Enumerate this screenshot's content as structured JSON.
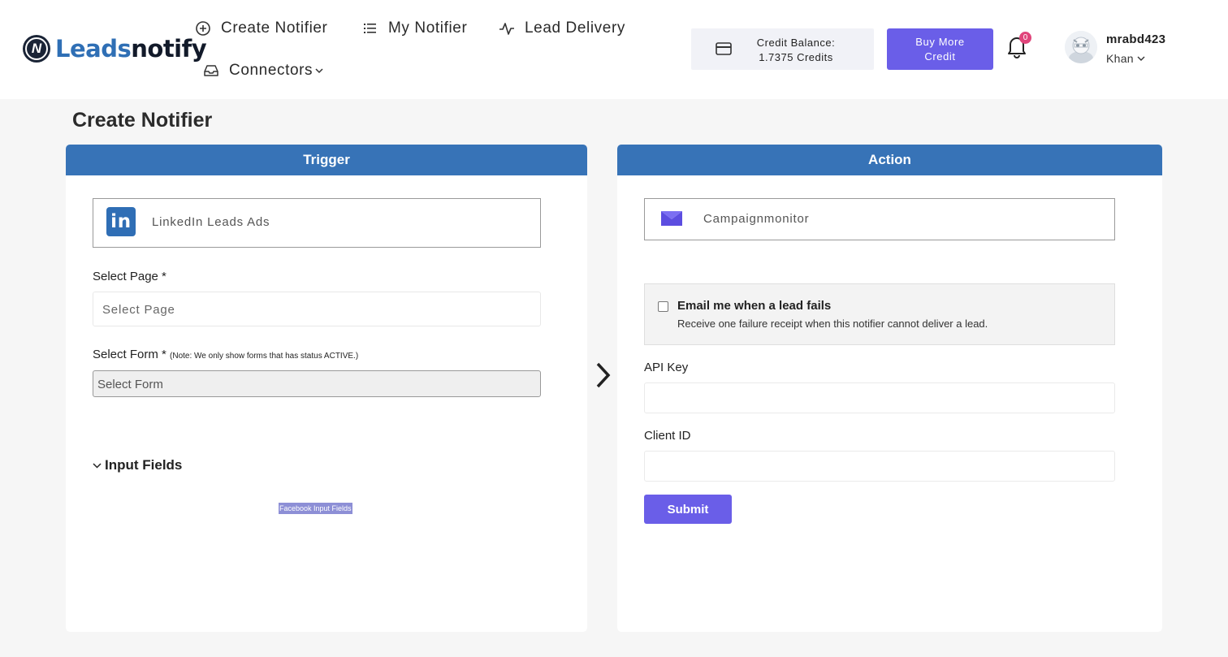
{
  "brand": {
    "name_part1": "Leads",
    "name_part2": "notify",
    "mark_letter": "N"
  },
  "nav": {
    "create_notifier": "Create Notifier",
    "my_notifier": "My Notifier",
    "lead_delivery": "Lead Delivery",
    "connectors": "Connectors"
  },
  "credit": {
    "line1": "Credit Balance:",
    "line2": "1.7375 Credits"
  },
  "buy_button": {
    "line1": "Buy More",
    "line2": "Credit"
  },
  "notifications": {
    "count": "0"
  },
  "user": {
    "name": "mrabd423",
    "sub": "Khan"
  },
  "page": {
    "title": "Create Notifier"
  },
  "trigger": {
    "header": "Trigger",
    "app_name": "LinkedIn Leads Ads",
    "app_logo_text": "in",
    "select_page_label": "Select Page *",
    "select_page_placeholder": "Select Page",
    "select_form_label": "Select Form *",
    "select_form_note": "(Note: We only show forms that has status ACTIVE.)",
    "select_form_value": "Select Form",
    "input_fields_label": "Input Fields",
    "fb_chip": "Facebook Input Fields"
  },
  "action": {
    "header": "Action",
    "app_name": "Campaignmonitor",
    "email_title": "Email me when a lead fails",
    "email_desc": "Receive one failure receipt when this notifier cannot deliver a lead.",
    "api_key_label": "API Key",
    "api_key_value": "",
    "client_id_label": "Client ID",
    "client_id_value": "",
    "submit_label": "Submit"
  },
  "colors": {
    "brand_blue": "#2f6fb5",
    "header_blue": "#3773b7",
    "accent_purple": "#6a5ee8",
    "badge_pink": "#e0457b"
  },
  "icons": [
    "plus-circle-icon",
    "list-icon",
    "activity-icon",
    "inbox-icon",
    "chevron-down-icon",
    "credit-card-icon",
    "bell-icon",
    "linkedin-icon",
    "campaignmonitor-icon",
    "chevron-right-icon"
  ]
}
